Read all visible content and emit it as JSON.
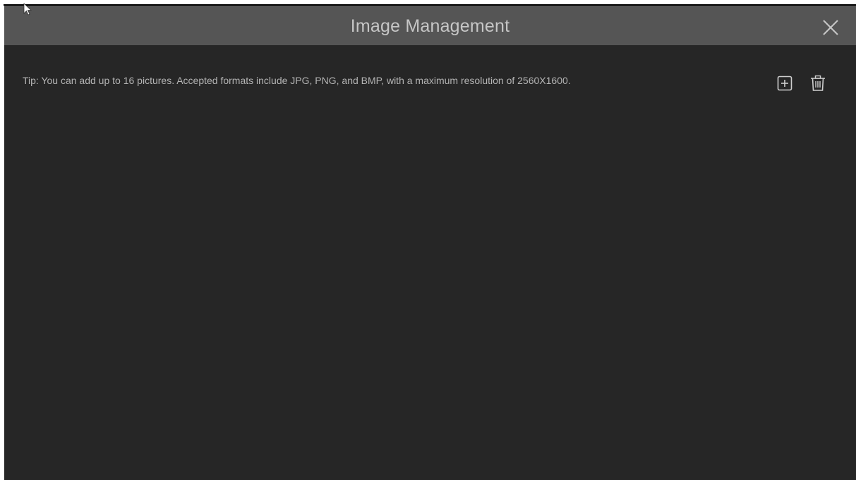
{
  "dialog": {
    "title": "Image Management",
    "close_icon": "close-icon"
  },
  "content": {
    "tip": "Tip: You can add up to 16 pictures. Accepted formats include JPG, PNG, and BMP, with a maximum resolution of 2560X1600."
  },
  "toolbar": {
    "add_icon": "add-icon",
    "delete_icon": "trash-icon"
  },
  "colors": {
    "title_bar": "#555555",
    "dialog_background": "#262626",
    "title_text": "#c6c6c6",
    "body_text": "#b4b4b4"
  }
}
